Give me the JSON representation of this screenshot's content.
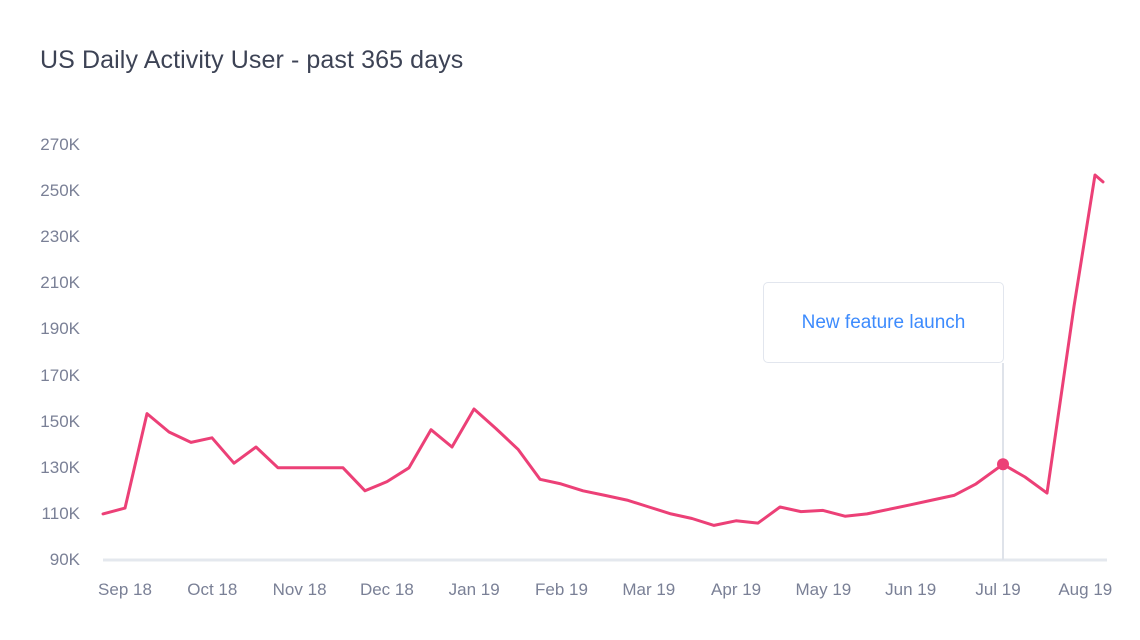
{
  "chart_data": {
    "type": "line",
    "title": "US Daily Activity User - past 365 days",
    "xlabel": "",
    "ylabel": "",
    "ylim": [
      90000,
      270000
    ],
    "ytick_labels": [
      "270K",
      "250K",
      "230K",
      "210K",
      "190K",
      "170K",
      "150K",
      "130K",
      "110K",
      "90K"
    ],
    "ytick_values": [
      270000,
      250000,
      230000,
      210000,
      190000,
      170000,
      150000,
      130000,
      110000,
      90000
    ],
    "categories": [
      "Sep 18",
      "Oct 18",
      "Nov 18",
      "Dec 18",
      "Jan 19",
      "Feb 19",
      "Mar 19",
      "Apr 19",
      "May 19",
      "Jun 19",
      "Jul 19",
      "Aug 19"
    ],
    "grid": false,
    "legend": null,
    "line_color": "#ec4077",
    "x": [
      103,
      125,
      147,
      169,
      191,
      212,
      234,
      256,
      278,
      300,
      321,
      343,
      365,
      387,
      409,
      431,
      452,
      474,
      496,
      518,
      540,
      561,
      583,
      605,
      627,
      649,
      671,
      692,
      714,
      736,
      758,
      780,
      801,
      823,
      845,
      867,
      889,
      911,
      932,
      954,
      976,
      1003,
      1025,
      1047,
      1074,
      1095,
      1103
    ],
    "values": [
      110000,
      112500,
      153500,
      145500,
      141000,
      143000,
      132000,
      139000,
      130000,
      130000,
      130000,
      130000,
      120000,
      124000,
      130000,
      146500,
      139000,
      155500,
      147000,
      138000,
      125000,
      123000,
      120000,
      118000,
      116000,
      113000,
      110000,
      108000,
      105000,
      107000,
      106000,
      113000,
      111000,
      111500,
      109000,
      110000,
      112000,
      114000,
      116000,
      118000,
      123000,
      131500,
      126000,
      119000,
      200000,
      257000,
      254000
    ],
    "marker_point": {
      "x_label": "Jul 19",
      "value": 131500,
      "color": "#ec4077"
    },
    "annotations": [
      {
        "label": "New feature launch",
        "text_color": "#3d8bfd",
        "border_color": "#e2e6ee",
        "vertical_line_x_label": "Jul 19",
        "vertical_line_color": "#dfe3ea"
      }
    ],
    "axis_line_color": "#e4e8ee",
    "tick_label_color": "#7a8096"
  }
}
